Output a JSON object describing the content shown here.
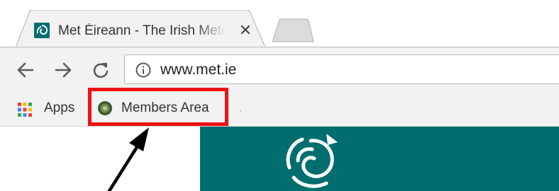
{
  "window": {
    "tab": {
      "title": "Met Éireann - The Irish Meteorological Service",
      "favicon": "met-eireann-swirl-icon",
      "close_icon": "close-icon"
    },
    "new_tab_icon": "new-tab-icon"
  },
  "toolbar": {
    "back_icon": "back-arrow-icon",
    "forward_icon": "forward-arrow-icon",
    "reload_icon": "reload-icon",
    "site_info_icon": "info-icon",
    "url": "www.met.ie"
  },
  "bookmarks_bar": {
    "apps": {
      "label": "Apps",
      "icon": "apps-grid-icon"
    },
    "members_area": {
      "label": "Members Area",
      "icon": "members-area-favicon"
    }
  },
  "page": {
    "banner_color": "#006d6e",
    "logo_icon": "met-eireann-logo-icon"
  },
  "annotation": {
    "highlight_color": "#ee1111",
    "arrow_color": "#000000"
  }
}
